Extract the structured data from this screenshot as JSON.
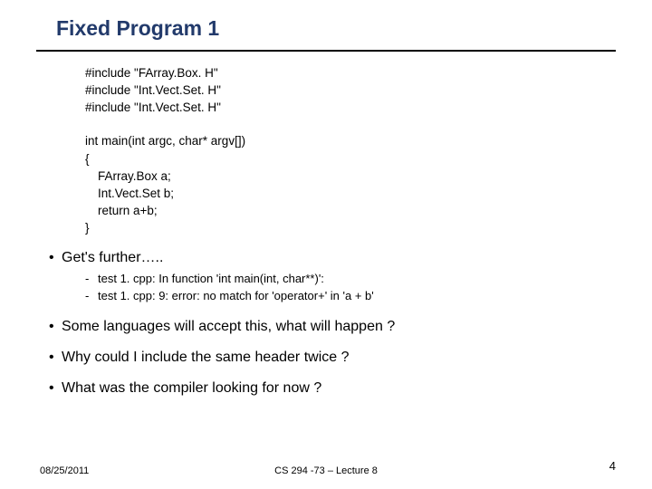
{
  "title": "Fixed Program 1",
  "code": {
    "l1": "#include \"FArray.Box. H\"",
    "l2": "#include \"Int.Vect.Set. H\"",
    "l3": "#include \"Int.Vect.Set. H\"",
    "l4": "int main(int argc, char* argv[])",
    "l5": "{",
    "l6": "FArray.Box a;",
    "l7": "Int.Vect.Set b;",
    "l8": "return a+b;",
    "l9": "}"
  },
  "bullets": {
    "b1": "Get's further…..",
    "sub1": "test 1. cpp: In function 'int main(int, char**)':",
    "sub2": "test 1. cpp: 9: error: no match for 'operator+' in 'a + b'",
    "b2": "Some languages will accept this, what will happen ?",
    "b3": "Why could I include the same header twice ?",
    "b4": "What was the compiler looking for now ?"
  },
  "footer": {
    "date": "08/25/2011",
    "center": "CS 294 -73 – Lecture 8",
    "page": "4"
  }
}
